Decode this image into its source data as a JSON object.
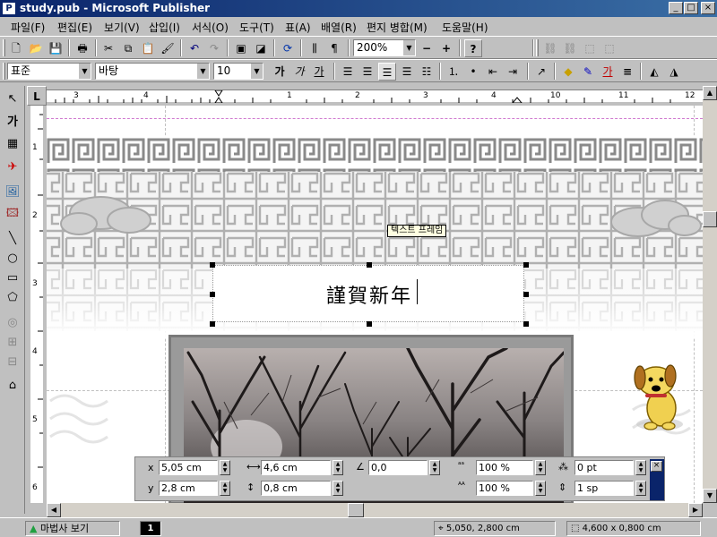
{
  "window": {
    "title": "study.pub - Microsoft Publisher",
    "icon_label": "P",
    "buttons": {
      "minimize": "_",
      "maximize": "□",
      "close": "×"
    }
  },
  "menu": [
    {
      "label": "파일(F)"
    },
    {
      "label": "편집(E)"
    },
    {
      "label": "보기(V)"
    },
    {
      "label": "삽입(I)"
    },
    {
      "label": "서식(O)"
    },
    {
      "label": "도구(T)"
    },
    {
      "label": "표(A)"
    },
    {
      "label": "배열(R)"
    },
    {
      "label": "편지 병합(M)"
    },
    {
      "label": "도움말(H)"
    }
  ],
  "standard_toolbar": {
    "zoom": "200%",
    "zoom_out": "−",
    "zoom_in": "+",
    "help": "?"
  },
  "format_toolbar": {
    "style": "표준",
    "font": "바탕",
    "size": "10",
    "bold": "가",
    "italic": "가",
    "underline": "가"
  },
  "ruler": {
    "corner": "L",
    "h_numbers": [
      "3",
      "4",
      "1",
      "2",
      "3",
      "4",
      "10",
      "11",
      "12"
    ],
    "v_numbers": [
      "1",
      "2",
      "3",
      "4",
      "5",
      "6"
    ]
  },
  "text_frame": {
    "text": "謹賀新年",
    "label": "텍스트 프레임"
  },
  "measurements": {
    "x_label": "x",
    "x": "5,05 cm",
    "y_label": "y",
    "y": "2,8 cm",
    "width": "4,6 cm",
    "height": "0,8 cm",
    "rotation": "0,0",
    "scale_width": "100 %",
    "scale_height": "100 %",
    "spacing": "0 pt",
    "line_spacing": "1 sp",
    "close": "×"
  },
  "status": {
    "wizard": "마법사 보기",
    "page": "1",
    "position": "5,050, 2,800 cm",
    "size": "4,600 x   0,800 cm"
  },
  "colors": {
    "title_start": "#0a246a",
    "title_end": "#3a6ea5",
    "chrome": "#c0c0c0",
    "guide": "#d07ad0"
  }
}
